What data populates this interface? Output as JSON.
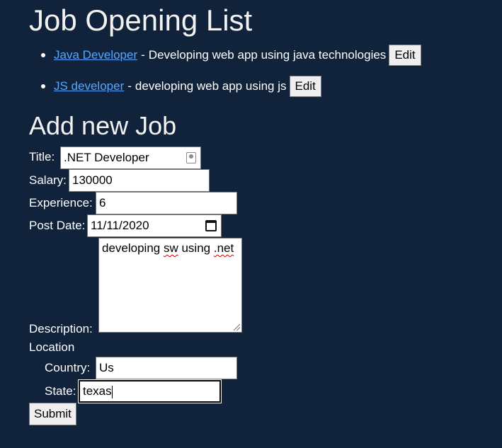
{
  "header": {
    "title": "Job Opening List"
  },
  "jobs": [
    {
      "title": "Java Developer",
      "separator": "-",
      "description": "Developing web app using java technologies",
      "edit_label": "Edit"
    },
    {
      "title": "JS developer",
      "separator": "-",
      "description": "developing web app using js",
      "edit_label": "Edit"
    }
  ],
  "form": {
    "heading": "Add new Job",
    "title_label": "Title:",
    "title_value": ".NET Developer",
    "salary_label": "Salary:",
    "salary_value": "130000",
    "experience_label": "Experience:",
    "experience_value": "6",
    "post_date_label": "Post Date:",
    "post_date_value": "11/11/2020",
    "description_label": "Description:",
    "description_value_part1": "developing ",
    "description_value_spell1": "sw",
    "description_value_part2": " using ",
    "description_value_spell2": ".net",
    "location_label": "Location",
    "country_label": "Country:",
    "country_value": "Us",
    "state_label": "State:",
    "state_value": "texas",
    "submit_label": "Submit"
  },
  "colors": {
    "background": "#10233a",
    "link": "#58a6ff"
  }
}
